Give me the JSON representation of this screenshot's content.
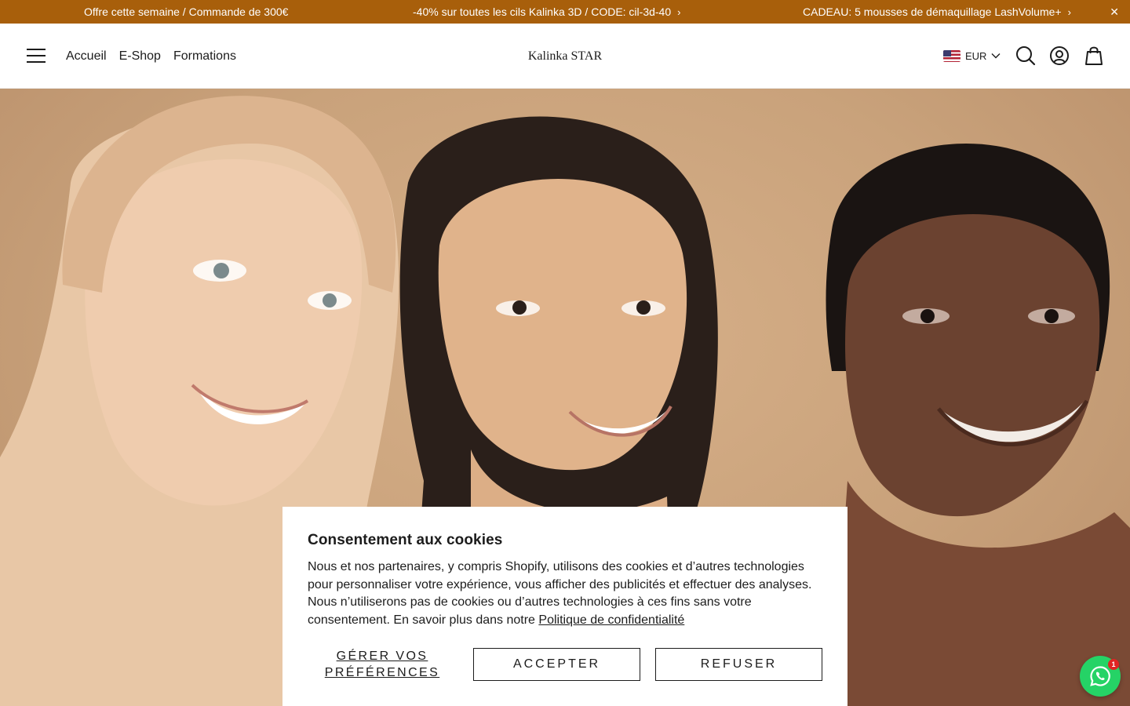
{
  "announcement": {
    "messages": [
      "Offre cette semaine / Commande de 300€",
      "-40% sur toutes les cils Kalinka 3D / CODE: cil-3d-40",
      "CADEAU: 5 mousses de démaquillage LashVolume+"
    ],
    "chevron": "›",
    "close": "✕",
    "background": "#a85f0b"
  },
  "header": {
    "menu_icon": "hamburger-icon",
    "nav": [
      "Accueil",
      "E-Shop",
      "Formations"
    ],
    "logo": "Kalinka STAR",
    "currency": "EUR",
    "currency_flag": "us-flag-icon",
    "icons": [
      "search-icon",
      "account-icon",
      "cart-icon"
    ]
  },
  "hero": {
    "image": "three smiling women portrait on beige background",
    "background": "#c9a27b"
  },
  "cookie": {
    "title": "Consentement aux cookies",
    "text": "Nous et nos partenaires, y compris Shopify, utilisons des cookies et d’autres technologies pour personnaliser votre expérience, vous afficher des publicités et effectuer des analyses. Nous n’utiliserons pas de cookies ou d’autres technologies à ces fins sans votre consentement. En savoir plus dans notre ",
    "link": "Politique de confidentialité",
    "buttons": {
      "preferences": "GÉRER VOS PRÉFÉRENCES",
      "accept": "ACCEPTER",
      "refuse": "REFUSER"
    }
  },
  "whatsapp": {
    "badge": "1",
    "color": "#25d366"
  }
}
